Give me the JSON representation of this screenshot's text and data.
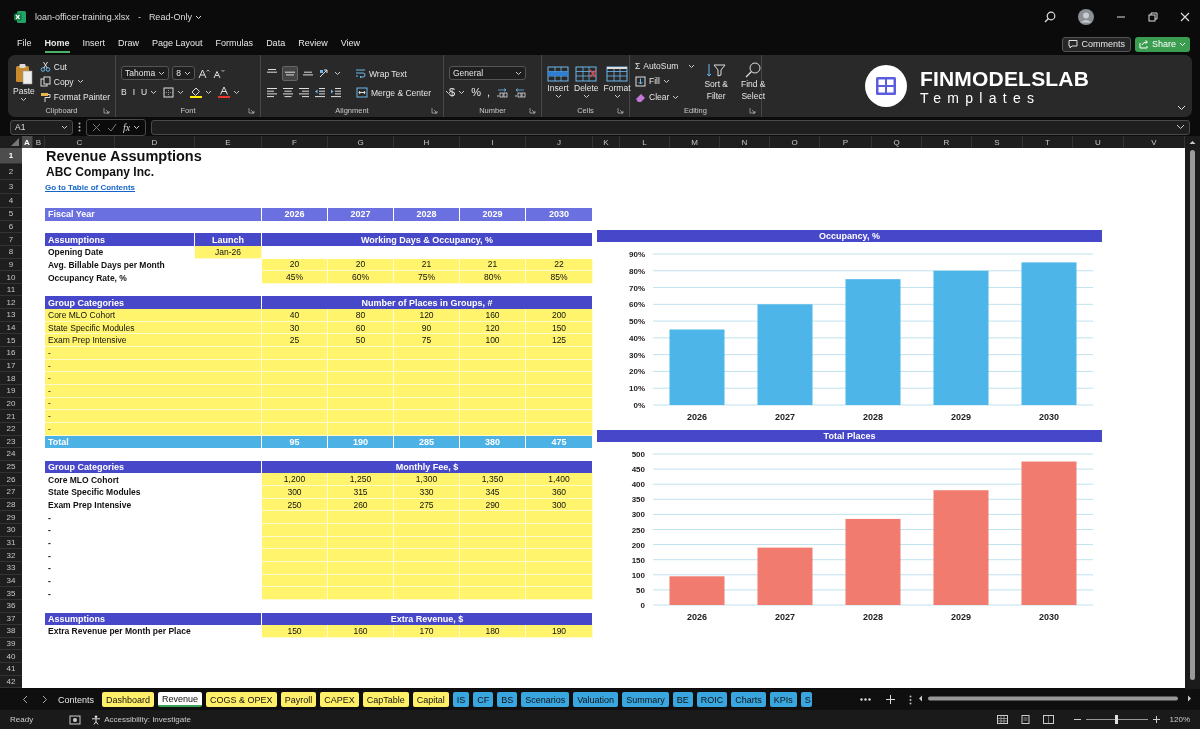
{
  "title_bar": {
    "file_name": "loan-officer-training.xlsx",
    "separator": "-",
    "mode": "Read-Only"
  },
  "menu": [
    {
      "label": "File",
      "selected": false
    },
    {
      "label": "Home",
      "selected": true
    },
    {
      "label": "Insert",
      "selected": false
    },
    {
      "label": "Draw",
      "selected": false
    },
    {
      "label": "Page Layout",
      "selected": false
    },
    {
      "label": "Formulas",
      "selected": false
    },
    {
      "label": "Data",
      "selected": false
    },
    {
      "label": "Review",
      "selected": false
    },
    {
      "label": "View",
      "selected": false
    }
  ],
  "comments_button": "Comments",
  "share_button": "Share",
  "ribbon": {
    "clipboard": {
      "paste": "Paste",
      "cut": "Cut",
      "copy": "Copy",
      "format_painter": "Format Painter",
      "label": "Clipboard"
    },
    "font": {
      "font_name": "Tahoma",
      "font_size": "8",
      "bold": "B",
      "italic": "I",
      "underline": "U",
      "label": "Font"
    },
    "alignment": {
      "wrap_text": "Wrap Text",
      "merge_center": "Merge & Center",
      "label": "Alignment"
    },
    "number": {
      "format": "General",
      "currency": "$",
      "percent": "%",
      "comma": ",",
      "label": "Number"
    },
    "cells": {
      "insert": "Insert",
      "delete": "Delete",
      "format": "Format",
      "label": "Cells"
    },
    "editing": {
      "sum_symbol": "Σ",
      "autosum": "AutoSum",
      "fill": "Fill",
      "clear": "Clear",
      "sort_filter": "Sort & Filter",
      "find_select": "Find & Select",
      "label": "Editing"
    }
  },
  "logo": {
    "name": "FINMODELSLAB",
    "tagline": "Templates"
  },
  "formula_bar": {
    "name_box": "A1",
    "function_button": "fx"
  },
  "columns": [
    {
      "label": "A",
      "selected": true
    },
    {
      "label": "B",
      "selected": false
    },
    {
      "label": "C",
      "selected": false
    },
    {
      "label": "D",
      "selected": false
    },
    {
      "label": "E",
      "selected": false
    },
    {
      "label": "F",
      "selected": false
    },
    {
      "label": "G",
      "selected": false
    },
    {
      "label": "H",
      "selected": false
    },
    {
      "label": "I",
      "selected": false
    },
    {
      "label": "J",
      "selected": false
    },
    {
      "label": "K",
      "selected": false
    },
    {
      "label": "L",
      "selected": false
    },
    {
      "label": "M",
      "selected": false
    },
    {
      "label": "N",
      "selected": false
    },
    {
      "label": "O",
      "selected": false
    },
    {
      "label": "P",
      "selected": false
    },
    {
      "label": "Q",
      "selected": false
    },
    {
      "label": "R",
      "selected": false
    },
    {
      "label": "S",
      "selected": false
    },
    {
      "label": "T",
      "selected": false
    },
    {
      "label": "U",
      "selected": false
    },
    {
      "label": "V",
      "selected": false
    }
  ],
  "rows": [
    {
      "number": "1",
      "selected": true,
      "kind": "title",
      "text": "Revenue Assumptions"
    },
    {
      "number": "2",
      "selected": false,
      "kind": "subtitle",
      "text": "ABC Company Inc."
    },
    {
      "number": "3",
      "selected": false,
      "kind": "link",
      "text": "Go to Table of Contents"
    },
    {
      "number": "4",
      "selected": false,
      "kind": "blank"
    },
    {
      "number": "5",
      "selected": false,
      "kind": "fiscal",
      "label": "Fiscal Year",
      "values": [
        "2026",
        "2027",
        "2028",
        "2029",
        "2030"
      ]
    },
    {
      "number": "6",
      "selected": false,
      "kind": "blank"
    },
    {
      "number": "7",
      "selected": false,
      "kind": "header",
      "label": "Assumptions",
      "mid": "Launch",
      "span": "Working Days & Occupancy, %"
    },
    {
      "number": "8",
      "selected": false,
      "kind": "data",
      "label": "Opening Date",
      "bold": true,
      "label_filled": false,
      "launch": "Jan-26",
      "values_filled": false
    },
    {
      "number": "9",
      "selected": false,
      "kind": "data",
      "label": "Avg. Billable Days per Month",
      "bold": true,
      "label_filled": false,
      "values_filled": true,
      "values": [
        "20",
        "20",
        "21",
        "21",
        "22"
      ]
    },
    {
      "number": "10",
      "selected": false,
      "kind": "data",
      "label": "Occupancy Rate, %",
      "bold": true,
      "label_filled": false,
      "values_filled": true,
      "values": [
        "45%",
        "60%",
        "75%",
        "80%",
        "85%"
      ]
    },
    {
      "number": "11",
      "selected": false,
      "kind": "blank"
    },
    {
      "number": "12",
      "selected": false,
      "kind": "header",
      "label": "Group Categories",
      "span": "Number of Places in Groups, #"
    },
    {
      "number": "13",
      "selected": false,
      "kind": "data",
      "label": "Core MLO Cohort",
      "bold": false,
      "label_filled": true,
      "values_filled": true,
      "values": [
        "40",
        "80",
        "120",
        "160",
        "200"
      ]
    },
    {
      "number": "14",
      "selected": false,
      "kind": "data",
      "label": "State Specific Modules",
      "bold": false,
      "label_filled": true,
      "values_filled": true,
      "values": [
        "30",
        "60",
        "90",
        "120",
        "150"
      ]
    },
    {
      "number": "15",
      "selected": false,
      "kind": "data",
      "label": "Exam Prep Intensive",
      "bold": false,
      "label_filled": true,
      "values_filled": true,
      "values": [
        "25",
        "50",
        "75",
        "100",
        "125"
      ]
    },
    {
      "number": "16",
      "selected": false,
      "kind": "data",
      "label": "-",
      "bold": false,
      "label_filled": true,
      "values_filled": true
    },
    {
      "number": "17",
      "selected": false,
      "kind": "data",
      "label": "-",
      "bold": false,
      "label_filled": true,
      "values_filled": true
    },
    {
      "number": "18",
      "selected": false,
      "kind": "data",
      "label": "-",
      "bold": false,
      "label_filled": true,
      "values_filled": true
    },
    {
      "number": "19",
      "selected": false,
      "kind": "data",
      "label": "-",
      "bold": false,
      "label_filled": true,
      "values_filled": true
    },
    {
      "number": "20",
      "selected": false,
      "kind": "data",
      "label": "-",
      "bold": false,
      "label_filled": true,
      "values_filled": true
    },
    {
      "number": "21",
      "selected": false,
      "kind": "data",
      "label": "-",
      "bold": false,
      "label_filled": true,
      "values_filled": true
    },
    {
      "number": "22",
      "selected": false,
      "kind": "data",
      "label": "-",
      "bold": false,
      "label_filled": true,
      "values_filled": true
    },
    {
      "number": "23",
      "selected": false,
      "kind": "total",
      "label": "Total",
      "values": [
        "95",
        "190",
        "285",
        "380",
        "475"
      ]
    },
    {
      "number": "24",
      "selected": false,
      "kind": "blank"
    },
    {
      "number": "25",
      "selected": false,
      "kind": "header",
      "label": "Group Categories",
      "span": "Monthly Fee, $"
    },
    {
      "number": "26",
      "selected": false,
      "kind": "data",
      "label": "Core MLO Cohort",
      "bold": true,
      "label_filled": false,
      "values_filled": true,
      "values": [
        "1,200",
        "1,250",
        "1,300",
        "1,350",
        "1,400"
      ]
    },
    {
      "number": "27",
      "selected": false,
      "kind": "data",
      "label": "State Specific Modules",
      "bold": true,
      "label_filled": false,
      "values_filled": true,
      "values": [
        "300",
        "315",
        "330",
        "345",
        "360"
      ]
    },
    {
      "number": "28",
      "selected": false,
      "kind": "data",
      "label": "Exam Prep Intensive",
      "bold": true,
      "label_filled": false,
      "values_filled": true,
      "values": [
        "250",
        "260",
        "275",
        "290",
        "300"
      ]
    },
    {
      "number": "29",
      "selected": false,
      "kind": "data",
      "label": "-",
      "bold": true,
      "label_filled": false,
      "values_filled": true
    },
    {
      "number": "30",
      "selected": false,
      "kind": "data",
      "label": "-",
      "bold": true,
      "label_filled": false,
      "values_filled": true
    },
    {
      "number": "31",
      "selected": false,
      "kind": "data",
      "label": "-",
      "bold": true,
      "label_filled": false,
      "values_filled": true
    },
    {
      "number": "32",
      "selected": false,
      "kind": "data",
      "label": "-",
      "bold": true,
      "label_filled": false,
      "values_filled": true
    },
    {
      "number": "33",
      "selected": false,
      "kind": "data",
      "label": "-",
      "bold": true,
      "label_filled": false,
      "values_filled": true
    },
    {
      "number": "34",
      "selected": false,
      "kind": "data",
      "label": "-",
      "bold": true,
      "label_filled": false,
      "values_filled": true
    },
    {
      "number": "35",
      "selected": false,
      "kind": "data",
      "label": "-",
      "bold": true,
      "label_filled": false,
      "values_filled": true
    },
    {
      "number": "36",
      "selected": false,
      "kind": "blank"
    },
    {
      "number": "37",
      "selected": false,
      "kind": "header",
      "label": "Assumptions",
      "span": "Extra Revenue, $"
    },
    {
      "number": "38",
      "selected": false,
      "kind": "data",
      "label": "Extra Revenue per Month per Place",
      "bold": true,
      "label_filled": false,
      "values_filled": true,
      "values": [
        "150",
        "160",
        "170",
        "180",
        "190"
      ]
    },
    {
      "number": "39",
      "selected": false,
      "kind": "blank"
    },
    {
      "number": "40",
      "selected": false,
      "kind": "blank"
    },
    {
      "number": "41",
      "selected": false,
      "kind": "blank"
    },
    {
      "number": "42",
      "selected": false,
      "kind": "blank"
    }
  ],
  "charts": [
    {
      "chart_data": {
        "type": "bar",
        "title": "Occupancy, %",
        "categories": [
          "2026",
          "2027",
          "2028",
          "2029",
          "2030"
        ],
        "series": [
          {
            "color": "#4db5e8",
            "values": [
              45,
              60,
              75,
              80,
              85
            ]
          }
        ],
        "grid": true,
        "ylim": [
          0,
          90
        ],
        "yticks": [
          {
            "value": 0,
            "label": "0%"
          },
          {
            "value": 10,
            "label": "10%"
          },
          {
            "value": 20,
            "label": "20%"
          },
          {
            "value": 30,
            "label": "30%"
          },
          {
            "value": 40,
            "label": "40%"
          },
          {
            "value": 50,
            "label": "50%"
          },
          {
            "value": 60,
            "label": "60%"
          },
          {
            "value": 70,
            "label": "70%"
          },
          {
            "value": 80,
            "label": "80%"
          },
          {
            "value": 90,
            "label": "90%"
          }
        ]
      }
    },
    {
      "chart_data": {
        "type": "bar",
        "title": "Total Places",
        "categories": [
          "2026",
          "2027",
          "2028",
          "2029",
          "2030"
        ],
        "series": [
          {
            "color": "#f07b6e",
            "values": [
              95,
              190,
              285,
              380,
              475
            ]
          }
        ],
        "grid": true,
        "ylim": [
          0,
          500
        ],
        "yticks": [
          0,
          50,
          100,
          150,
          200,
          250,
          300,
          350,
          400,
          450,
          500
        ]
      }
    }
  ],
  "sheet_tabs": [
    {
      "label": "Contents",
      "selected": false
    },
    {
      "label": "Dashboard",
      "selected": false,
      "color": "#fff06a"
    },
    {
      "label": "Revenue",
      "selected": true
    },
    {
      "label": "COGS & OPEX",
      "selected": false,
      "color": "#fff06a"
    },
    {
      "label": "Payroll",
      "selected": false,
      "color": "#fff06a"
    },
    {
      "label": "CAPEX",
      "selected": false,
      "color": "#fff06a"
    },
    {
      "label": "CapTable",
      "selected": false,
      "color": "#fff06a"
    },
    {
      "label": "Capital",
      "selected": false,
      "color": "#fff06a"
    },
    {
      "label": "IS",
      "selected": false,
      "color": "#3aa6e0"
    },
    {
      "label": "CF",
      "selected": false,
      "color": "#3aa6e0"
    },
    {
      "label": "BS",
      "selected": false,
      "color": "#3aa6e0"
    },
    {
      "label": "Scenarios",
      "selected": false,
      "color": "#3aa6e0"
    },
    {
      "label": "Valuation",
      "selected": false,
      "color": "#3aa6e0"
    },
    {
      "label": "Summary",
      "selected": false,
      "color": "#3aa6e0"
    },
    {
      "label": "BE",
      "selected": false,
      "color": "#3aa6e0"
    },
    {
      "label": "ROIC",
      "selected": false,
      "color": "#3aa6e0"
    },
    {
      "label": "Charts",
      "selected": false,
      "color": "#3aa6e0"
    },
    {
      "label": "KPIs",
      "selected": false,
      "color": "#3aa6e0"
    },
    {
      "label": "S",
      "selected": false,
      "color": "#3aa6e0"
    }
  ],
  "status_bar": {
    "mode": "Ready",
    "accessibility": "Accessibility: Investigate",
    "zoom": {
      "level": 0.5,
      "reading": "120%"
    }
  }
}
